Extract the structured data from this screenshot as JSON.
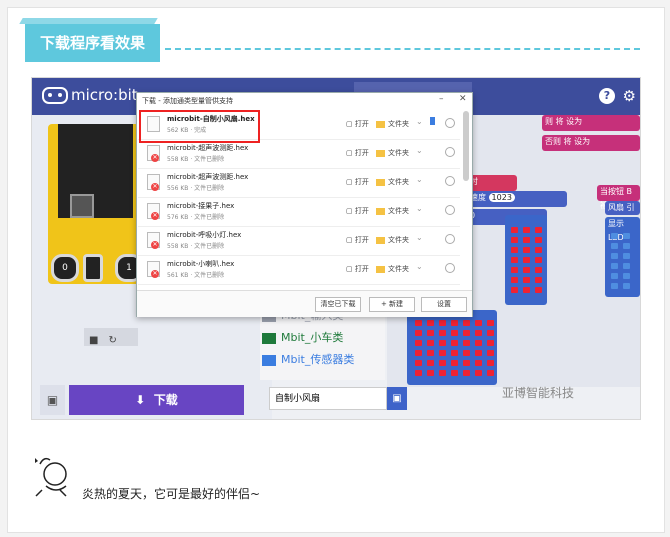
{
  "header": {
    "title": "下载程序看效果"
  },
  "app": {
    "logo_text": "micro:bit",
    "help_icon": "help-icon",
    "settings_icon": "gear-icon",
    "download_label": "下载",
    "project_name": "自制小风扇",
    "watermark": "亚博智能科技"
  },
  "simulator": {
    "pin0": "0",
    "pin1": "1"
  },
  "toolbox": {
    "items": [
      {
        "label": "Mbit_输入类",
        "color": "#9aa0ad"
      },
      {
        "label": "Mbit_小车类",
        "color": "#1f7a3b"
      },
      {
        "label": "Mbit_传感器类",
        "color": "#3b7de0"
      }
    ]
  },
  "blocks": {
    "b1": "则  将  设为",
    "b2": "否则  将  设为",
    "b3": "时",
    "b4": "速度",
    "speed_value": "1023",
    "b5": "0",
    "b6": "当按钮  B  被",
    "b7": "风扇  引脚",
    "b8": "显示 LED"
  },
  "dialog": {
    "title": "下载 - 添加通类型量管供支持",
    "files": [
      {
        "name": "microbit-自制小风扇.hex",
        "meta": "562 KB  · 完成",
        "open": "打开",
        "folder": "文件夹",
        "failed": false
      },
      {
        "name": "microbit-超声波测距.hex",
        "meta": "558 KB  · 文件已删除",
        "open": "打开",
        "folder": "文件夹",
        "failed": true
      },
      {
        "name": "microbit-超声波测距.hex",
        "meta": "556 KB  · 文件已删除",
        "open": "打开",
        "folder": "文件夹",
        "failed": true
      },
      {
        "name": "microbit-接果子.hex",
        "meta": "576 KB  · 文件已删除",
        "open": "打开",
        "folder": "文件夹",
        "failed": true
      },
      {
        "name": "microbit-呼吸小灯.hex",
        "meta": "558 KB  · 文件已删除",
        "open": "打开",
        "folder": "文件夹",
        "failed": true
      },
      {
        "name": "microbit-小喇叭.hex",
        "meta": "561 KB  · 文件已删除",
        "open": "打开",
        "folder": "文件夹",
        "failed": true
      }
    ],
    "clear_label": "清空已下载",
    "new_label": "+ 新建",
    "settings_label": "设置"
  },
  "caption": "炎热的夏天，它可是最好的伴侣~"
}
